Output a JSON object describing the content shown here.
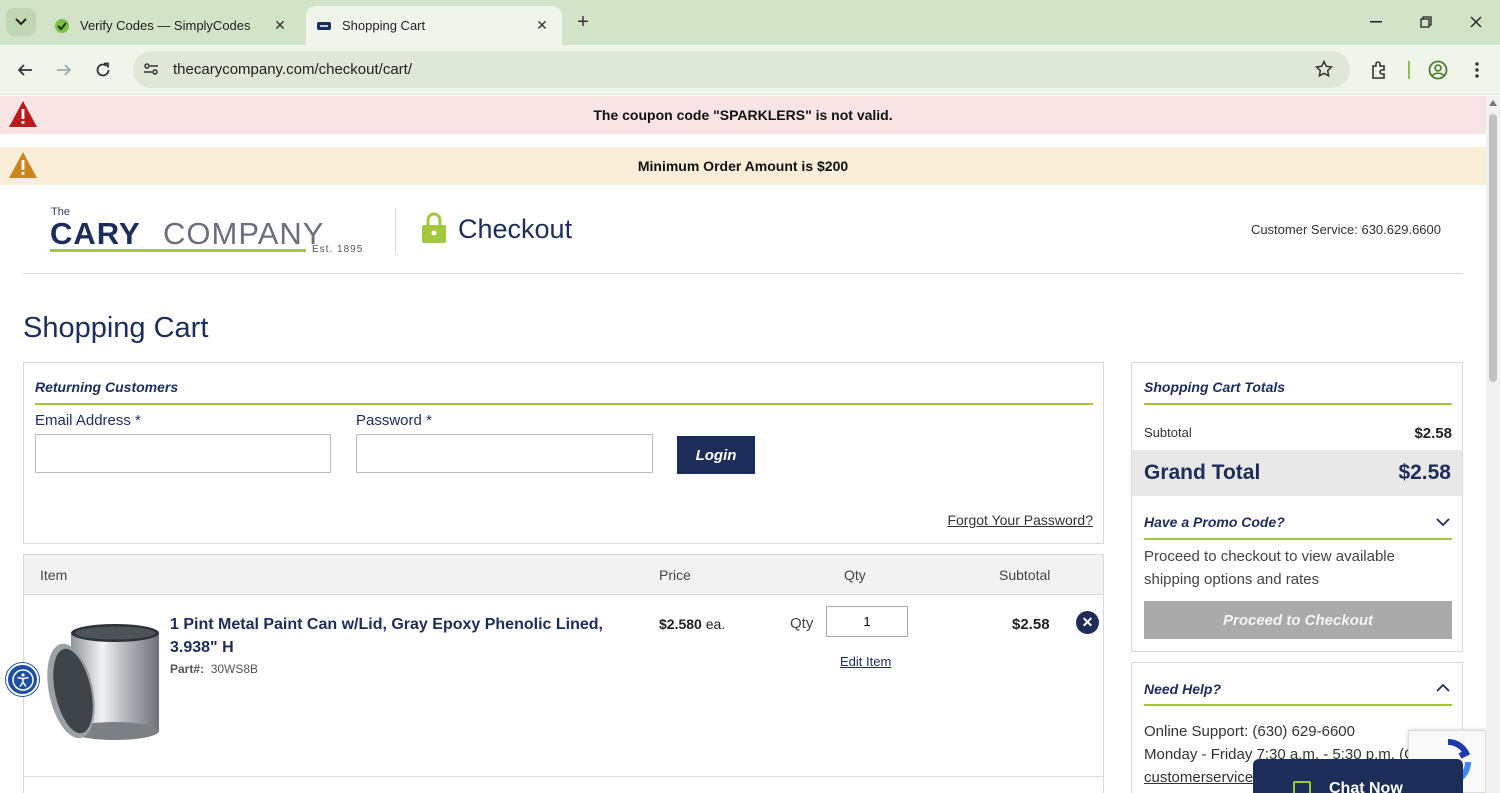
{
  "browser": {
    "tabs": [
      {
        "title": "Verify Codes — SimplyCodes",
        "active": false
      },
      {
        "title": "Shopping Cart",
        "active": true
      }
    ],
    "url": "thecarycompany.com/checkout/cart/"
  },
  "alerts": {
    "error": "The coupon code \"SPARKLERS\" is not valid.",
    "warning": "Minimum Order Amount is $200"
  },
  "header": {
    "logo_the": "The",
    "logo_cary": "CARY",
    "logo_company": "COMPANY",
    "logo_est": "Est. 1895",
    "checkout": "Checkout",
    "customer_service": "Customer Service: 630.629.6600"
  },
  "page_title": "Shopping Cart",
  "returning": {
    "heading": "Returning Customers",
    "email_label": "Email Address *",
    "email_value": "",
    "password_label": "Password *",
    "password_value": "",
    "login_button": "Login",
    "forgot": "Forgot Your Password?"
  },
  "cart": {
    "columns": {
      "item": "Item",
      "price": "Price",
      "qty": "Qty",
      "subtotal": "Subtotal"
    },
    "items": [
      {
        "name": "1 Pint Metal Paint Can w/Lid, Gray Epoxy Phenolic Lined, 3.938\" H",
        "part_label": "Part#:",
        "part_number": "30WS8B",
        "price": "$2.580",
        "price_unit": "ea.",
        "qty_label": "Qty",
        "qty": "1",
        "edit": "Edit Item",
        "subtotal": "$2.58"
      }
    ]
  },
  "totals": {
    "heading": "Shopping Cart Totals",
    "subtotal_label": "Subtotal",
    "subtotal_value": "$2.58",
    "grand_total_label": "Grand Total",
    "grand_total_value": "$2.58",
    "promo_heading": "Have a Promo Code?",
    "proceed_note": "Proceed to checkout to view available shipping options and rates",
    "proceed_button": "Proceed to Checkout"
  },
  "help": {
    "heading": "Need Help?",
    "online_support": "Online Support: (630) 629-6600",
    "hours": "Monday - Friday 7:30 a.m. - 5:30 p.m. (C",
    "email": "customerservice"
  },
  "chat": {
    "label": "Chat Now"
  },
  "colors": {
    "navy": "#1d2d59",
    "accent_green": "#a3c83d",
    "error_bg": "#f8e4e4",
    "warning_bg": "#fbeed9"
  }
}
